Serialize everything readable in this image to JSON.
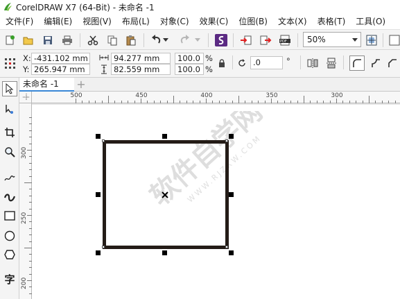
{
  "window": {
    "title": "CorelDRAW X7 (64-Bit) - 未命名 -1"
  },
  "menu": [
    "文件(F)",
    "编辑(E)",
    "视图(V)",
    "布局(L)",
    "对象(C)",
    "效果(C)",
    "位图(B)",
    "文本(X)",
    "表格(T)",
    "工具(O)"
  ],
  "toolbar": {
    "icons": [
      "new-document-icon",
      "open-icon",
      "save-icon",
      "print-icon",
      "cut-icon",
      "copy-icon",
      "paste-icon",
      "undo-icon",
      "redo-icon",
      "launcher-icon",
      "import-icon",
      "export-icon",
      "publish-pdf-icon",
      "full-screen-preview-icon"
    ],
    "zoom": "50%"
  },
  "properties": {
    "x_label": "X:",
    "x_value": "-431.102 mm",
    "y_label": "Y:",
    "y_value": "265.947 mm",
    "width_value": "94.277 mm",
    "height_value": "82.559 mm",
    "scale_x": "100.0",
    "scale_y": "100.0",
    "percent_x": "%",
    "percent_y": "%",
    "rotation": ".0",
    "degree_symbol": "°"
  },
  "document_tab": {
    "label": "未命名 -1",
    "add": "+"
  },
  "ruler": {
    "horizontal": [
      "500",
      "450",
      "400",
      "350",
      "300"
    ],
    "vertical": [
      "300",
      "250",
      "200"
    ]
  },
  "toolbox": {
    "icons": [
      "pick-tool-icon",
      "shape-tool-icon",
      "crop-tool-icon",
      "zoom-tool-icon",
      "freehand-tool-icon",
      "artistic-media-tool-icon",
      "rectangle-tool-icon",
      "ellipse-tool-icon",
      "polygon-tool-icon",
      "text-tool-icon"
    ],
    "text_tool_label": "字"
  },
  "watermark": {
    "text": "软件自学网",
    "url": "WWW.RJZXW.COM"
  },
  "colors": {
    "accent": "#3a87d6",
    "rect_stroke": "#241c17",
    "toolbar_bg": "#f4f4f4"
  }
}
